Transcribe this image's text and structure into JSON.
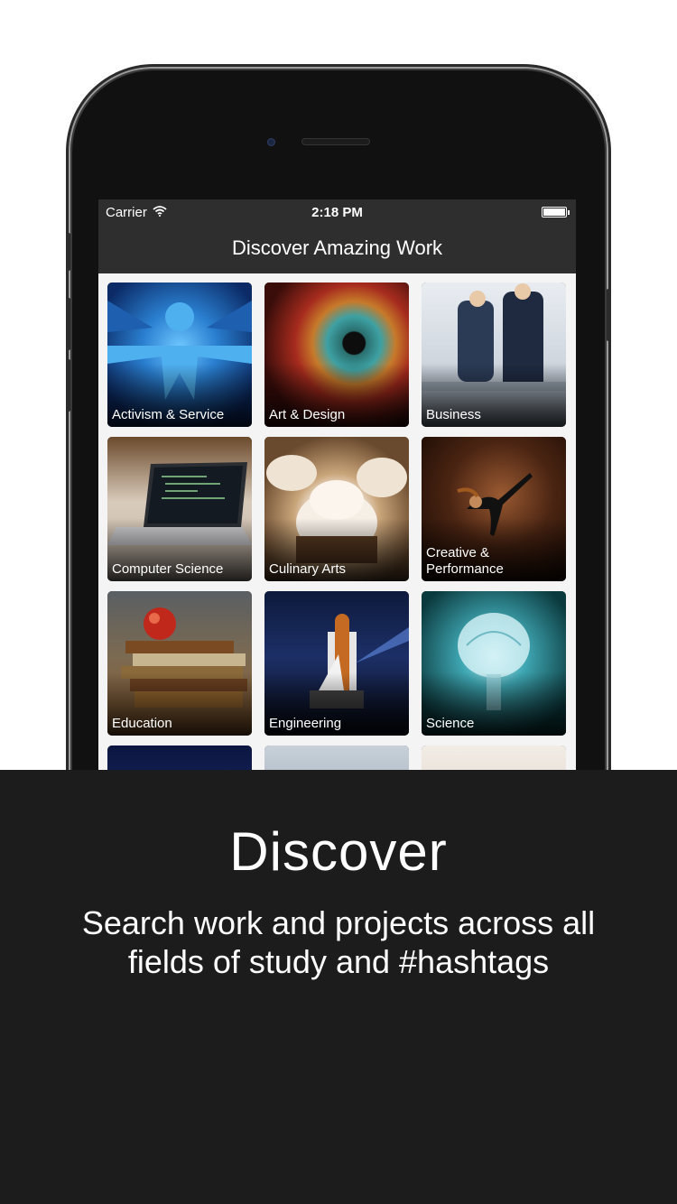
{
  "status_bar": {
    "carrier": "Carrier",
    "time": "2:18 PM"
  },
  "nav": {
    "title": "Discover Amazing Work"
  },
  "categories": [
    {
      "label": "Activism & Service"
    },
    {
      "label": "Art & Design"
    },
    {
      "label": "Business"
    },
    {
      "label": "Computer Science"
    },
    {
      "label": "Culinary Arts"
    },
    {
      "label": "Creative & Performance"
    },
    {
      "label": "Education"
    },
    {
      "label": "Engineering"
    },
    {
      "label": "Science"
    }
  ],
  "promo": {
    "title": "Discover",
    "subtitle": "Search work and projects across all fields of study and #hashtags"
  },
  "colors": {
    "navbar": "#2e2e2e",
    "panel": "#1c1c1c",
    "screen_bg": "#f4f4f4"
  },
  "icons": [
    "wifi-icon",
    "battery-icon"
  ]
}
